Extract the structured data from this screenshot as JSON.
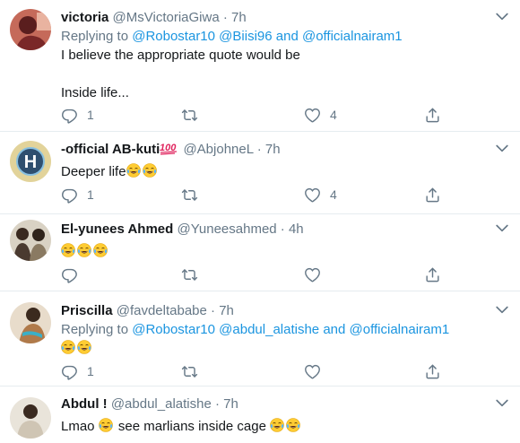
{
  "tweets": [
    {
      "name": "victoria",
      "handle": "@MsVictoriaGiwa",
      "time": "7h",
      "replying_label": "Replying to",
      "replying_to": [
        "@Robostar10",
        "@Biisi96",
        "@officialnairam1"
      ],
      "joiner": "and",
      "lines": [
        "I believe the appropriate quote would be",
        "",
        "Inside life..."
      ],
      "reply_count": "1",
      "retweet_count": "",
      "like_count": "4",
      "avatar_color": "#9a3a3a"
    },
    {
      "name": "-official AB-kuti",
      "name_emoji": "💯",
      "handle": "@AbjohneL",
      "time": "7h",
      "text": "Deeper life",
      "emoji_count": 2,
      "reply_count": "1",
      "retweet_count": "",
      "like_count": "4",
      "avatar_color": "#c9b26a"
    },
    {
      "name": "El-yunees Ahmed",
      "handle": "@Yuneesahmed",
      "time": "4h",
      "text": "",
      "emoji_count": 3,
      "reply_count": "",
      "retweet_count": "",
      "like_count": "",
      "avatar_color": "#6a5a48"
    },
    {
      "name": "Priscilla",
      "handle": "@favdeltababe",
      "time": "7h",
      "replying_label": "Replying to",
      "replying_to": [
        "@Robostar10",
        "@abdul_alatishe",
        "@officialnairam1"
      ],
      "joiner": "and",
      "text": "",
      "emoji_count": 2,
      "reply_count": "1",
      "retweet_count": "",
      "like_count": "",
      "avatar_color": "#caa56e"
    },
    {
      "name": "Abdul !",
      "handle": "@abdul_alatishe",
      "time": "7h",
      "text_before": "Lmao",
      "text_after": "see marlians inside cage",
      "avatar_color": "#a89a84"
    }
  ],
  "separator": "·",
  "colors": {
    "link": "#1b95e0",
    "muted": "#657786",
    "border": "#e6ecf0"
  },
  "icons": [
    "reply-icon",
    "retweet-icon",
    "like-icon",
    "share-icon",
    "chevron-down-icon",
    "laughing-crying-emoji-icon",
    "hundred-points-emoji-icon"
  ]
}
